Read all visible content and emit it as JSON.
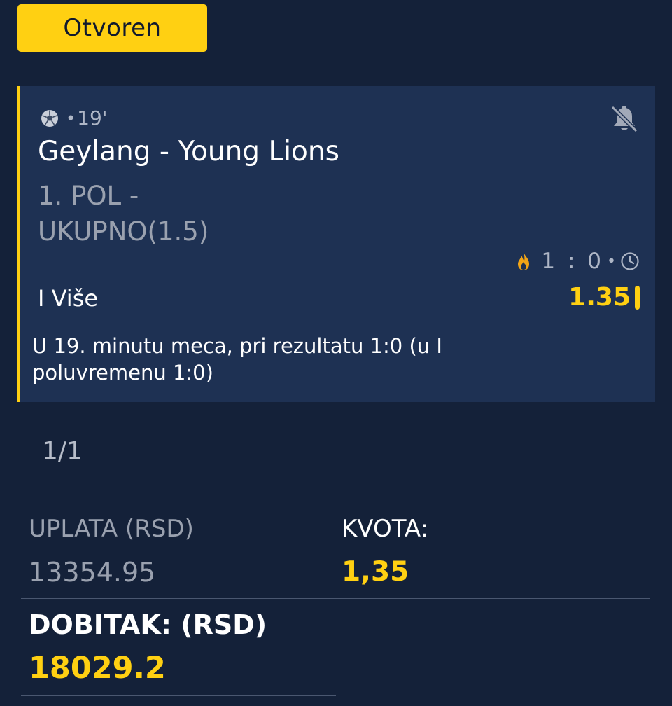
{
  "status_button": {
    "label": "Otvoren"
  },
  "bet": {
    "minute": "19'",
    "match": "Geylang - Young Lions",
    "market": "1. POL -\nUKUPNO(1.5)",
    "score": "1 : 0",
    "pick": "I Više",
    "odds": "1.35",
    "note": "U 19. minutu meca, pri rezultatu 1:0 (u I poluvremenu 1:0)"
  },
  "counter": "1/1",
  "stake": {
    "label": "UPLATA (RSD)",
    "value": "13354.95"
  },
  "kvota": {
    "label": "KVOTA:",
    "value": "1,35"
  },
  "winnings": {
    "label": "DOBITAK: (RSD)",
    "value": "18029.2"
  },
  "colors": {
    "background": "#142139",
    "card": "#1e3153",
    "accent": "#ffd012",
    "muted": "#9aa1af",
    "fire": "#f2a516"
  },
  "icons": [
    "soccer-ball-icon",
    "bell-off-icon",
    "fire-icon",
    "clock-icon"
  ]
}
